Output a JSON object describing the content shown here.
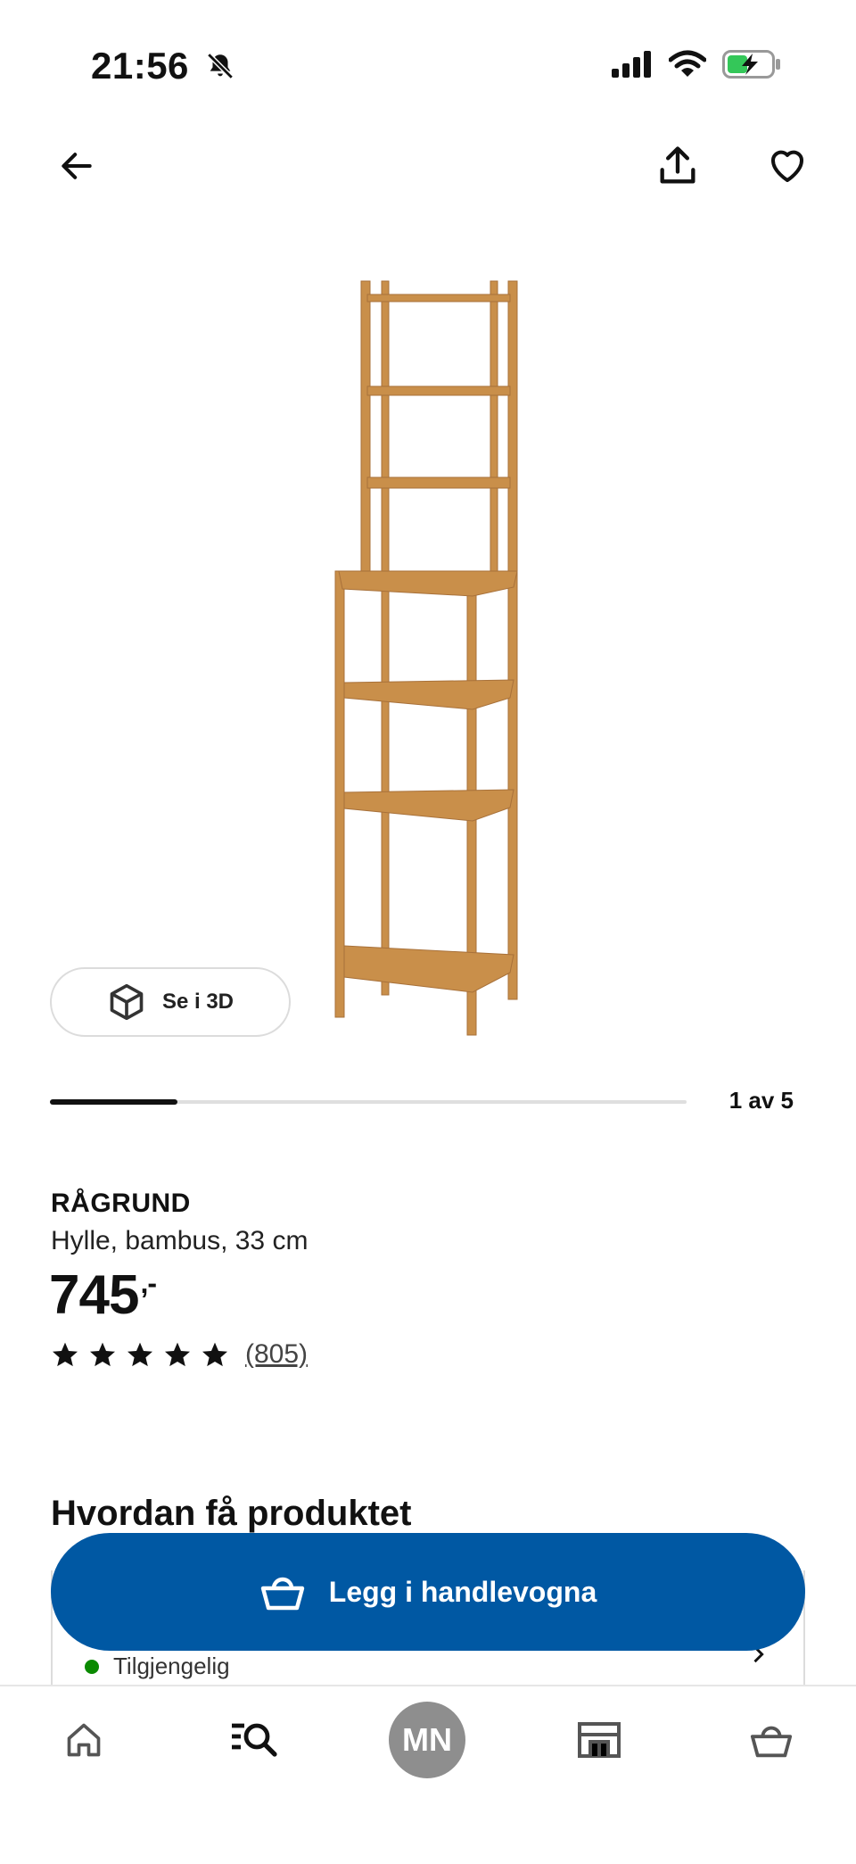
{
  "status_bar": {
    "time": "21:56"
  },
  "gallery": {
    "view_3d_label": "Se i 3D",
    "position_text": "1 av 5",
    "current": 1,
    "total": 5
  },
  "product": {
    "name": "RÅGRUND",
    "description": "Hylle, bambus, 33 cm",
    "price": "745",
    "price_suffix": ",-",
    "rating_stars": 5,
    "review_count": "(805)"
  },
  "delivery": {
    "title": "Hvordan få produktet",
    "availability": "Tilgjengelig"
  },
  "cart_button": {
    "label": "Legg i handlevogna"
  },
  "nav": {
    "avatar_initials": "MN"
  },
  "colors": {
    "accent": "#0058a3",
    "available": "#0a8a00",
    "wood": "#c98f4a"
  }
}
